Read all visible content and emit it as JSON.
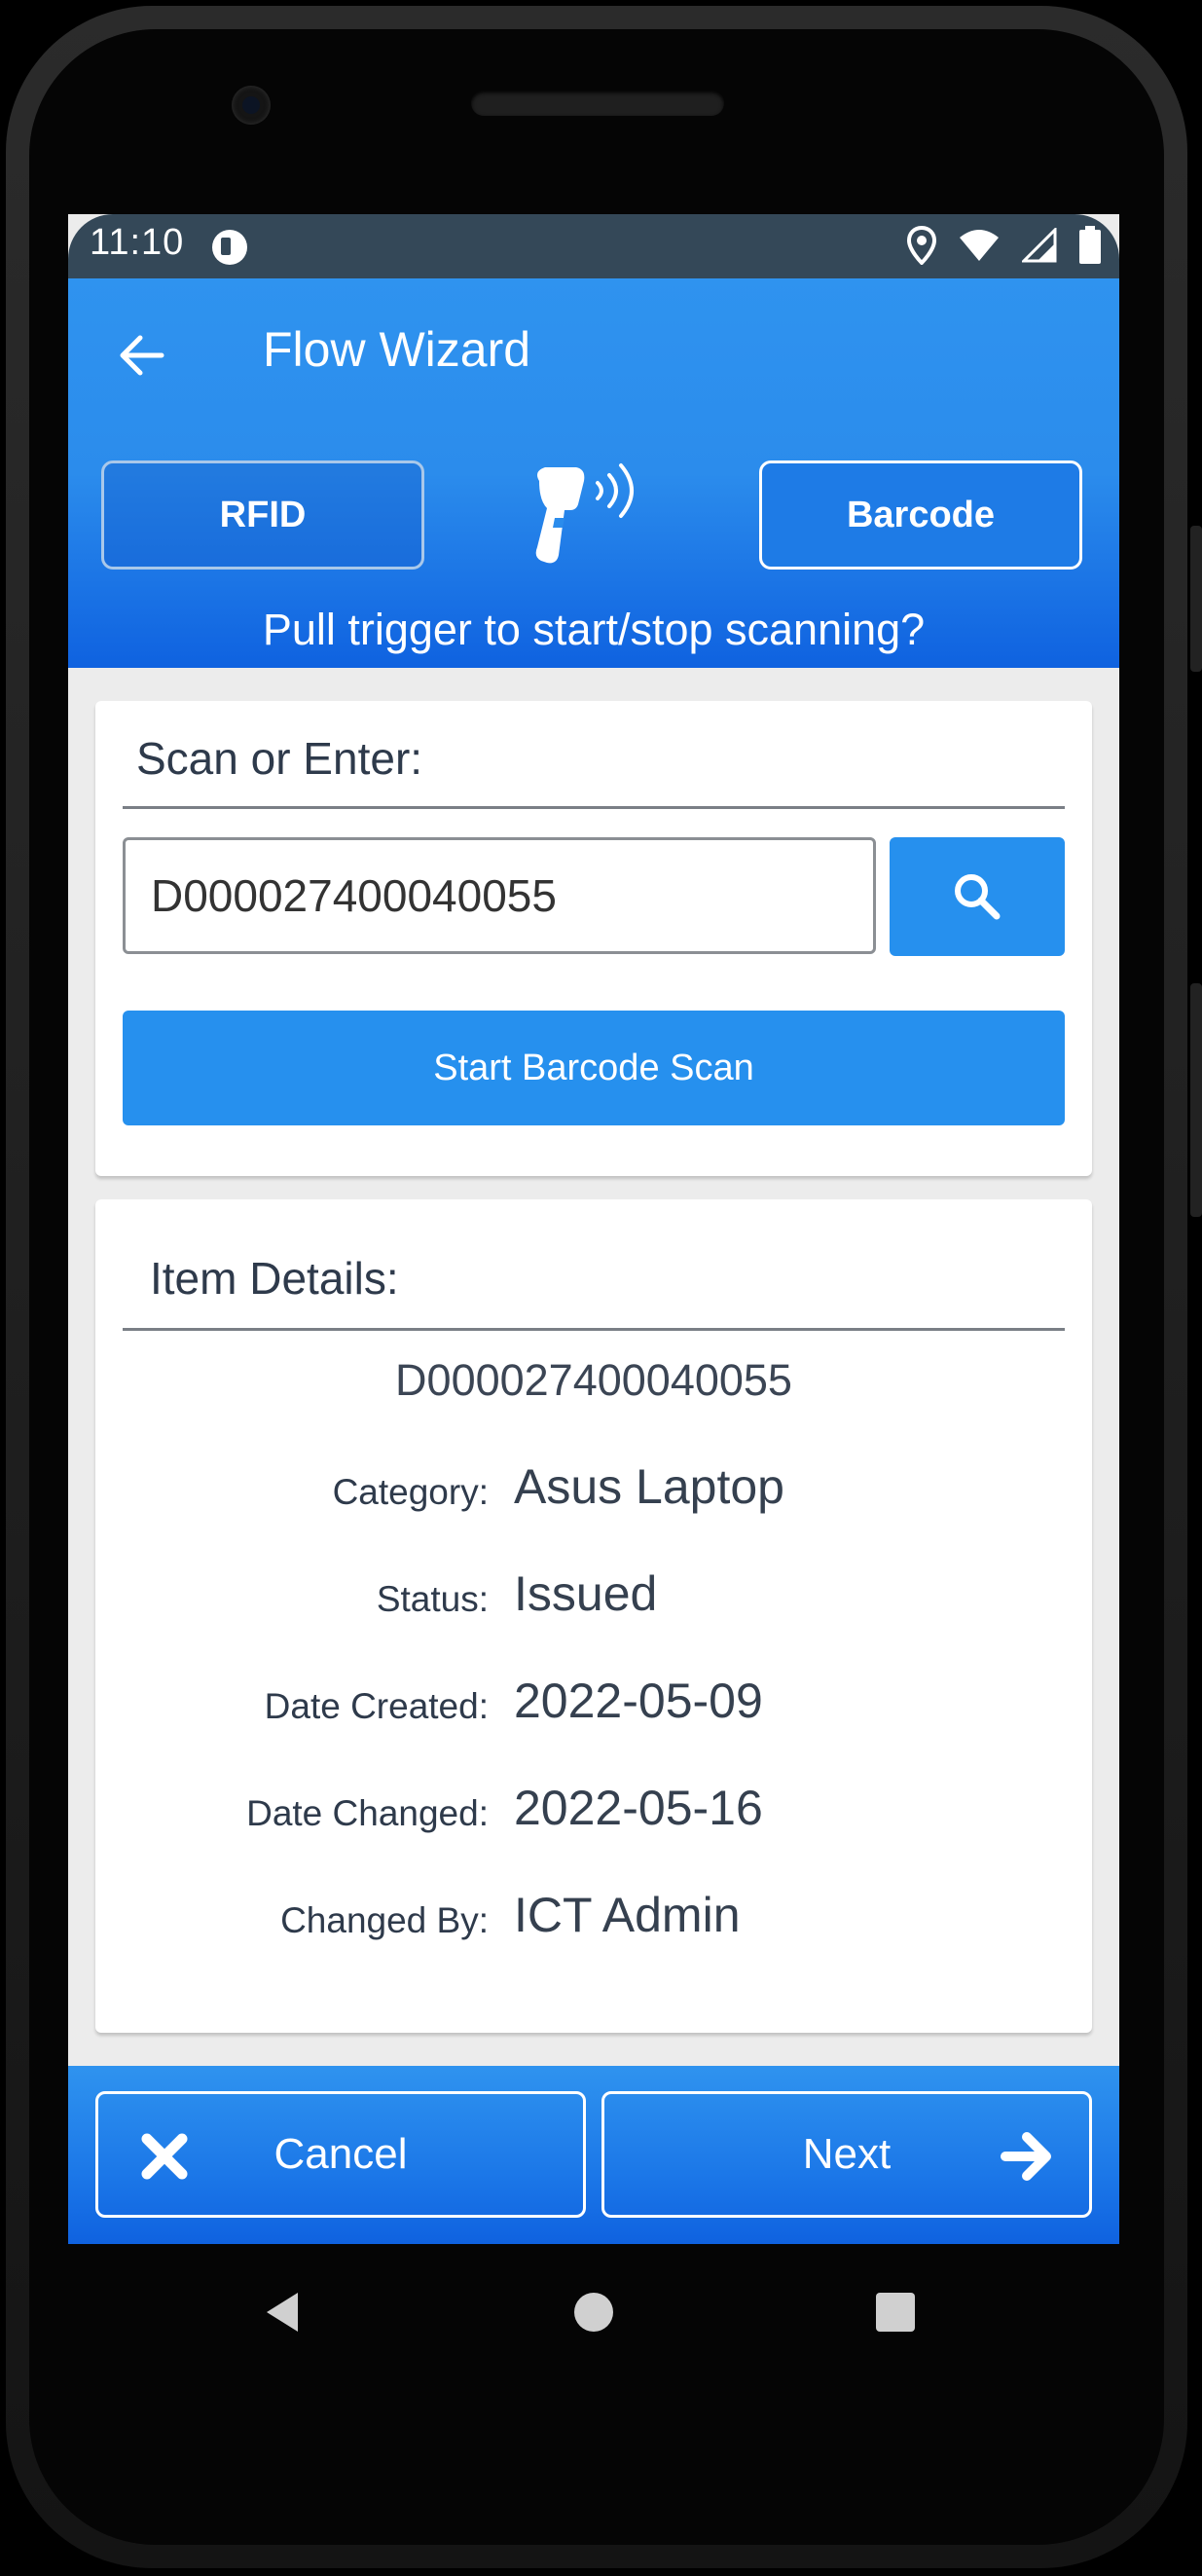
{
  "status_bar": {
    "time": "11:10"
  },
  "header": {
    "title": "Flow Wizard",
    "rfid_label": "RFID",
    "barcode_label": "Barcode",
    "hint": "Pull trigger to start/stop scanning?"
  },
  "scan_card": {
    "title": "Scan or Enter:",
    "input_value": "D000027400040055",
    "start_scan_label": "Start Barcode Scan"
  },
  "details_card": {
    "title": "Item Details:",
    "item_id": "D000027400040055",
    "rows": [
      {
        "label": "Category:",
        "value": "Asus Laptop"
      },
      {
        "label": "Status:",
        "value": "Issued"
      },
      {
        "label": "Date Created:",
        "value": "2022-05-09"
      },
      {
        "label": "Date Changed:",
        "value": "2022-05-16"
      },
      {
        "label": "Changed By:",
        "value": "ICT Admin"
      }
    ]
  },
  "footer": {
    "cancel_label": "Cancel",
    "next_label": "Next"
  },
  "colors": {
    "accent": "#2690ee",
    "header_dark": "#0f62e0",
    "status_bar": "#344858",
    "text": "#2e3a4b"
  },
  "icons": {
    "back": "arrow-left-icon",
    "scanner": "barcode-scanner-icon",
    "search": "search-icon",
    "cancel": "close-icon",
    "next": "arrow-right-icon"
  }
}
